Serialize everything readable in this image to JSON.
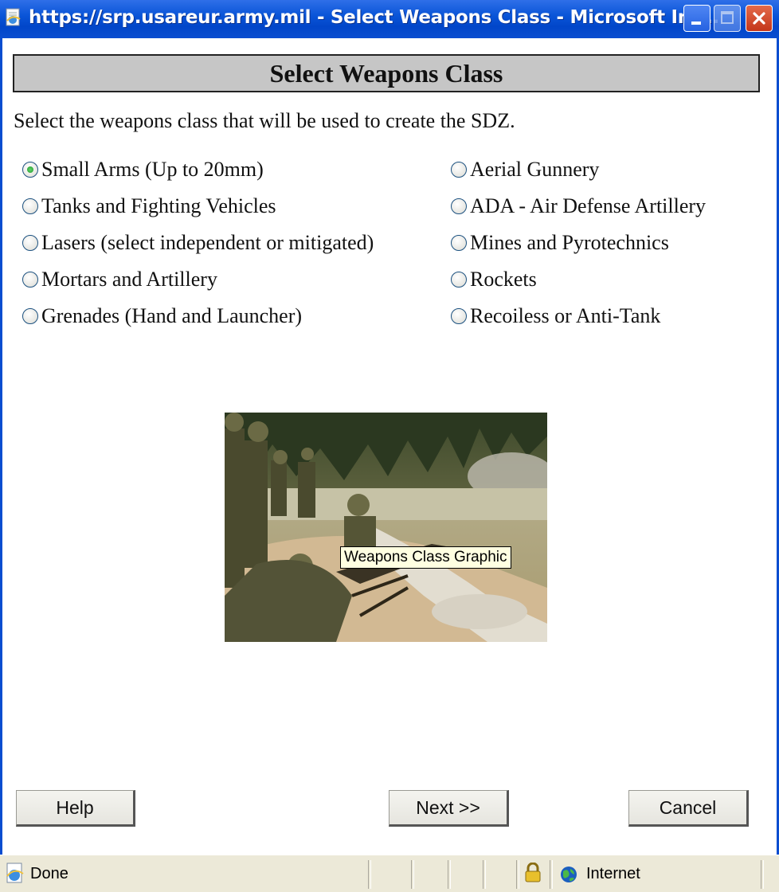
{
  "window": {
    "title": "https://srp.usareur.army.mil - Select Weapons Class - Microsoft Int...",
    "icons": [
      "ie-page-icon",
      "minimize-icon",
      "maximize-icon",
      "close-icon"
    ]
  },
  "page": {
    "heading": "Select Weapons Class",
    "intro": "Select the weapons class that will be used to create the SDZ."
  },
  "options": [
    {
      "label": "Small Arms (Up to 20mm)",
      "checked": true
    },
    {
      "label": "Tanks and Fighting Vehicles",
      "checked": false
    },
    {
      "label": "Lasers (select independent or mitigated)",
      "checked": false
    },
    {
      "label": "Mortars and Artillery",
      "checked": false
    },
    {
      "label": "Grenades (Hand and Launcher)",
      "checked": false
    },
    {
      "label": "Aerial Gunnery",
      "checked": false
    },
    {
      "label": "ADA - Air Defense Artillery",
      "checked": false
    },
    {
      "label": "Mines and Pyrotechnics",
      "checked": false
    },
    {
      "label": "Rockets",
      "checked": false
    },
    {
      "label": "Recoiless or Anti-Tank",
      "checked": false
    }
  ],
  "graphic": {
    "tooltip": "Weapons Class Graphic"
  },
  "buttons": {
    "help": "Help",
    "next": "Next >>",
    "cancel": "Cancel"
  },
  "status": {
    "text": "Done",
    "zone": "Internet",
    "icons": [
      "page-done-icon",
      "lock-icon",
      "globe-icon"
    ]
  },
  "colors": {
    "titlebar": "#0a4dd0",
    "header_bg": "#c6c6c6",
    "statusbar_bg": "#ece9d8",
    "radio_checked": "#1f9a2c",
    "tooltip_bg": "#ffffe1"
  }
}
